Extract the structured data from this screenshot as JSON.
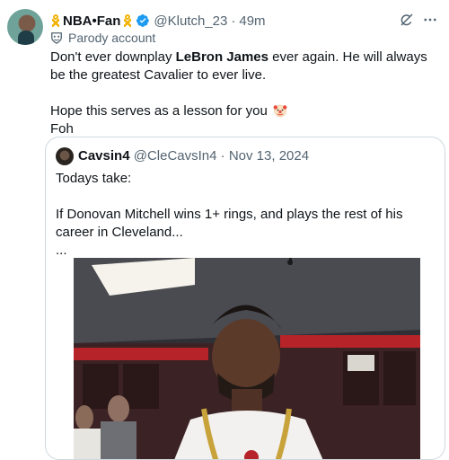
{
  "tweet": {
    "author_name": "NBA•Fan",
    "handle": "@Klutch_23",
    "separator": "·",
    "time": "49m",
    "badge": "Parody account",
    "text_line1_pre": "Don't ever downplay ",
    "text_line1_bold": "LeBron James",
    "text_line1_post": " ever again. He will always be the greatest Cavalier to ever live.",
    "text_line2": "Hope this serves as a lesson for you",
    "text_line3": "Foh"
  },
  "quoted": {
    "author_name": "Cavsin4",
    "handle": "@CleCavsIn4",
    "separator": "·",
    "date": "Nov 13, 2024",
    "line1": "Todays take:",
    "line2": "If Donovan Mitchell wins 1+ rings, and plays the rest of his career in Cleveland...",
    "line3": "..."
  },
  "icons": {
    "ribbon": "yellow-ribbon-icon",
    "verified": "verified-badge-icon",
    "grok": "grok-icon",
    "more": "more-icon",
    "parody": "parody-mask-icon",
    "clown": "clown-face-emoji"
  },
  "colors": {
    "verified": "#1d9bf0",
    "secondary_text": "#536471",
    "ribbon": "#f2b203",
    "border": "#cfd9de"
  }
}
